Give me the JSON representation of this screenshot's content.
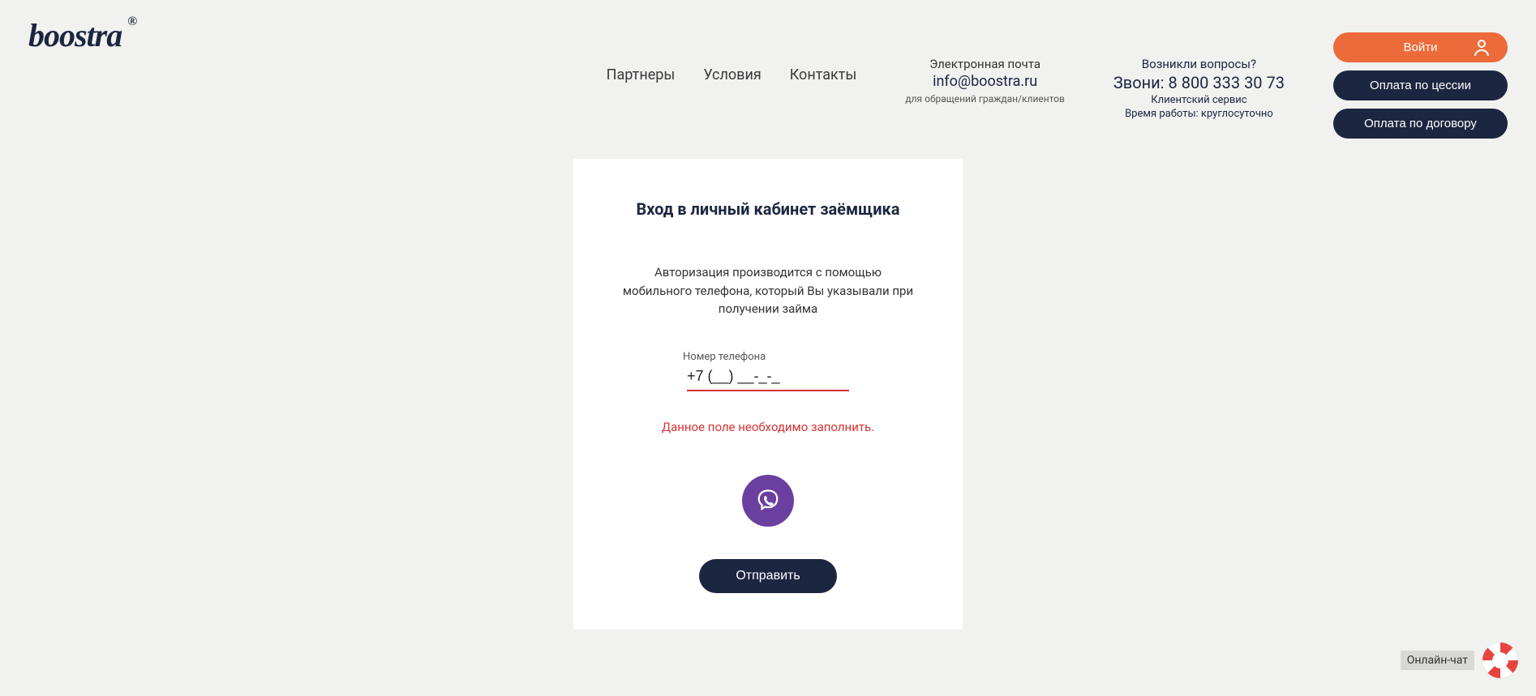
{
  "logo": {
    "text": "boostra",
    "registered": "®"
  },
  "nav": {
    "partners": "Партнеры",
    "terms": "Условия",
    "contacts": "Контакты"
  },
  "email_block": {
    "label": "Электронная почта",
    "email": "info@boostra.ru",
    "sub": "для обращений граждан/клиентов"
  },
  "phone_block": {
    "question": "Возникли вопросы?",
    "call_prefix": "Звони: ",
    "phone": "8 800 333 30 73",
    "service": "Клиентский сервис",
    "hours": "Время работы: круглосуточно"
  },
  "actions": {
    "login": "Войти",
    "pay_cession": "Оплата по цессии",
    "pay_contract": "Оплата по договору"
  },
  "login_card": {
    "title": "Вход в личный кабинет заёмщика",
    "desc": "Авторизация производится с помощью мобильного телефона, который Вы указывали при получении займа",
    "phone_label": "Номер телефона",
    "phone_placeholder": "+7 (__) __-_-_",
    "phone_value": "+7 (__) __-_-_",
    "error": "Данное поле необходимо заполнить.",
    "submit": "Отправить"
  },
  "chat": {
    "label": "Онлайн-чат"
  }
}
